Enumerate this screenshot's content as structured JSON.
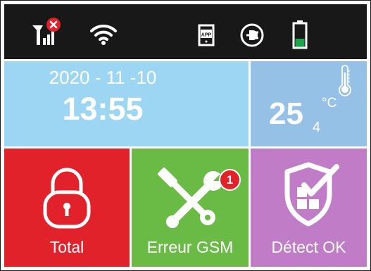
{
  "colors": {
    "status_bar": "#181818",
    "date_tile": "#9cd6f2",
    "temp_tile": "#96c1e7",
    "alarm_tile": "#e2222a",
    "gsm_tile": "#6aba46",
    "detect_tile": "#c17cc7",
    "battery_level": "#1aa64a",
    "badge": "#e2222a"
  },
  "status_bar": {
    "icons": [
      "signal-no-sim-icon",
      "wifi-icon",
      "app-icon",
      "ac-power-icon",
      "battery-icon"
    ],
    "battery_level": 0.35
  },
  "clock": {
    "date": "2020 - 11 -10",
    "time": "13:55"
  },
  "temperature": {
    "value": "25",
    "decimal": "4",
    "unit": "°C",
    "icon": "thermometer-icon"
  },
  "tiles": {
    "total": {
      "label": "Total",
      "icon": "padlock-icon"
    },
    "gsm": {
      "label": "Erreur GSM",
      "icon": "tools-icon",
      "badge": "1"
    },
    "detect": {
      "label": "Détect OK",
      "icon": "shield-check-icon"
    }
  }
}
